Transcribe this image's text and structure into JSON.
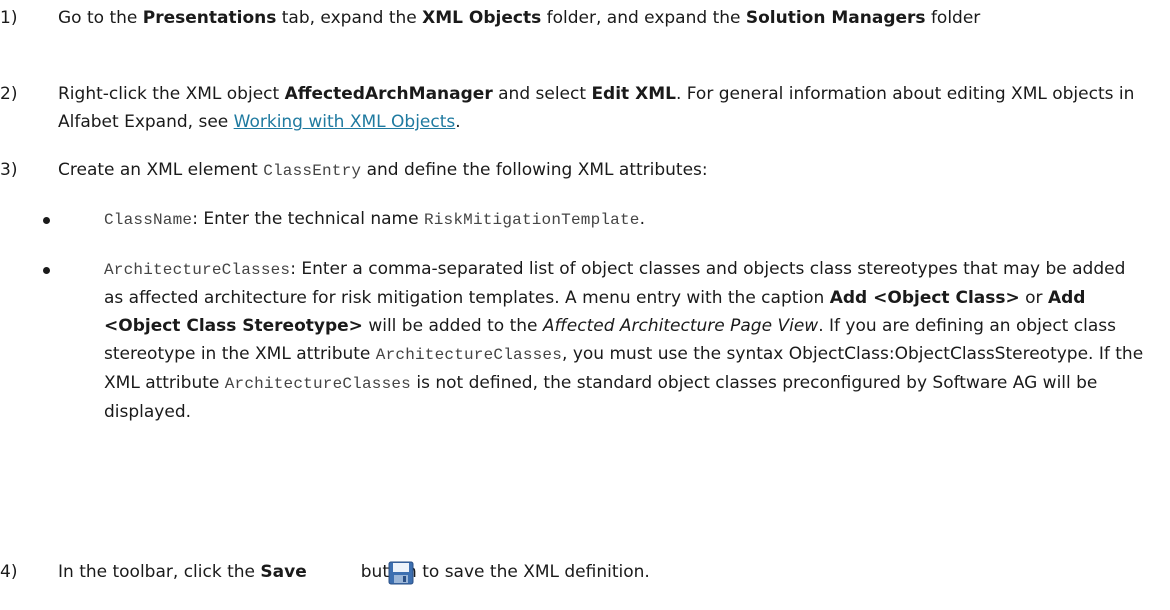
{
  "steps": [
    {
      "number": "1)",
      "parts": [
        {
          "t": "Go to the "
        },
        {
          "t": "Presentations",
          "b": true
        },
        {
          "t": " tab, expand the "
        },
        {
          "t": "XML Objects",
          "b": true
        },
        {
          "t": " folder, and expand the "
        },
        {
          "t": "Solution Managers",
          "b": true
        },
        {
          "t": " folder"
        }
      ]
    },
    {
      "number": "2)",
      "parts": [
        {
          "t": "Right-click the XML object "
        },
        {
          "t": "AffectedArchManager",
          "b": true
        },
        {
          "t": " and select "
        },
        {
          "t": "Edit XML",
          "b": true
        },
        {
          "t": ". For general information about editing XML objects in Alfabet Expand, see "
        },
        {
          "t": "Working with XML Objects",
          "link": true
        },
        {
          "t": "."
        }
      ]
    },
    {
      "number": "3)",
      "parts": [
        {
          "t": "Create an XML element "
        },
        {
          "t": "ClassEntry",
          "code": true
        },
        {
          "t": " and define the following XML attributes:"
        }
      ]
    },
    {
      "number": "4)",
      "parts": [
        {
          "t": "In the toolbar, click the "
        },
        {
          "t": "Save",
          "b": true
        },
        {
          "t": "          button to save the XML definition."
        }
      ]
    }
  ],
  "bullets": [
    {
      "parts": [
        {
          "t": "ClassName",
          "code": true
        },
        {
          "t": ": Enter the technical name "
        },
        {
          "t": "RiskMitigationTemplate",
          "code": true
        },
        {
          "t": "."
        }
      ]
    },
    {
      "parts": [
        {
          "t": "ArchitectureClasses",
          "code": true
        },
        {
          "t": ": Enter a comma-separated list of object classes and objects class stereotypes that may be added as affected architecture for risk mitigation templates. A menu entry with the caption "
        },
        {
          "t": "Add <Object Class>",
          "b": true
        },
        {
          "t": " or "
        },
        {
          "t": "Add <Object Class Stereotype>",
          "b": true
        },
        {
          "t": " will be added to the "
        },
        {
          "t": "Affected Architecture Page View",
          "i": true
        },
        {
          "t": ". If you are defining an object class stereotype in the XML attribute "
        },
        {
          "t": "ArchitectureClasses",
          "code": true
        },
        {
          "t": ", you must use the syntax ObjectClass:ObjectClassStereotype. If the XML attribute "
        },
        {
          "t": "ArchitectureClasses",
          "code": true
        },
        {
          "t": " is not defined, the standard object classes preconfigured by Software AG will be displayed."
        }
      ]
    }
  ],
  "icons": {
    "save": "save-icon"
  }
}
